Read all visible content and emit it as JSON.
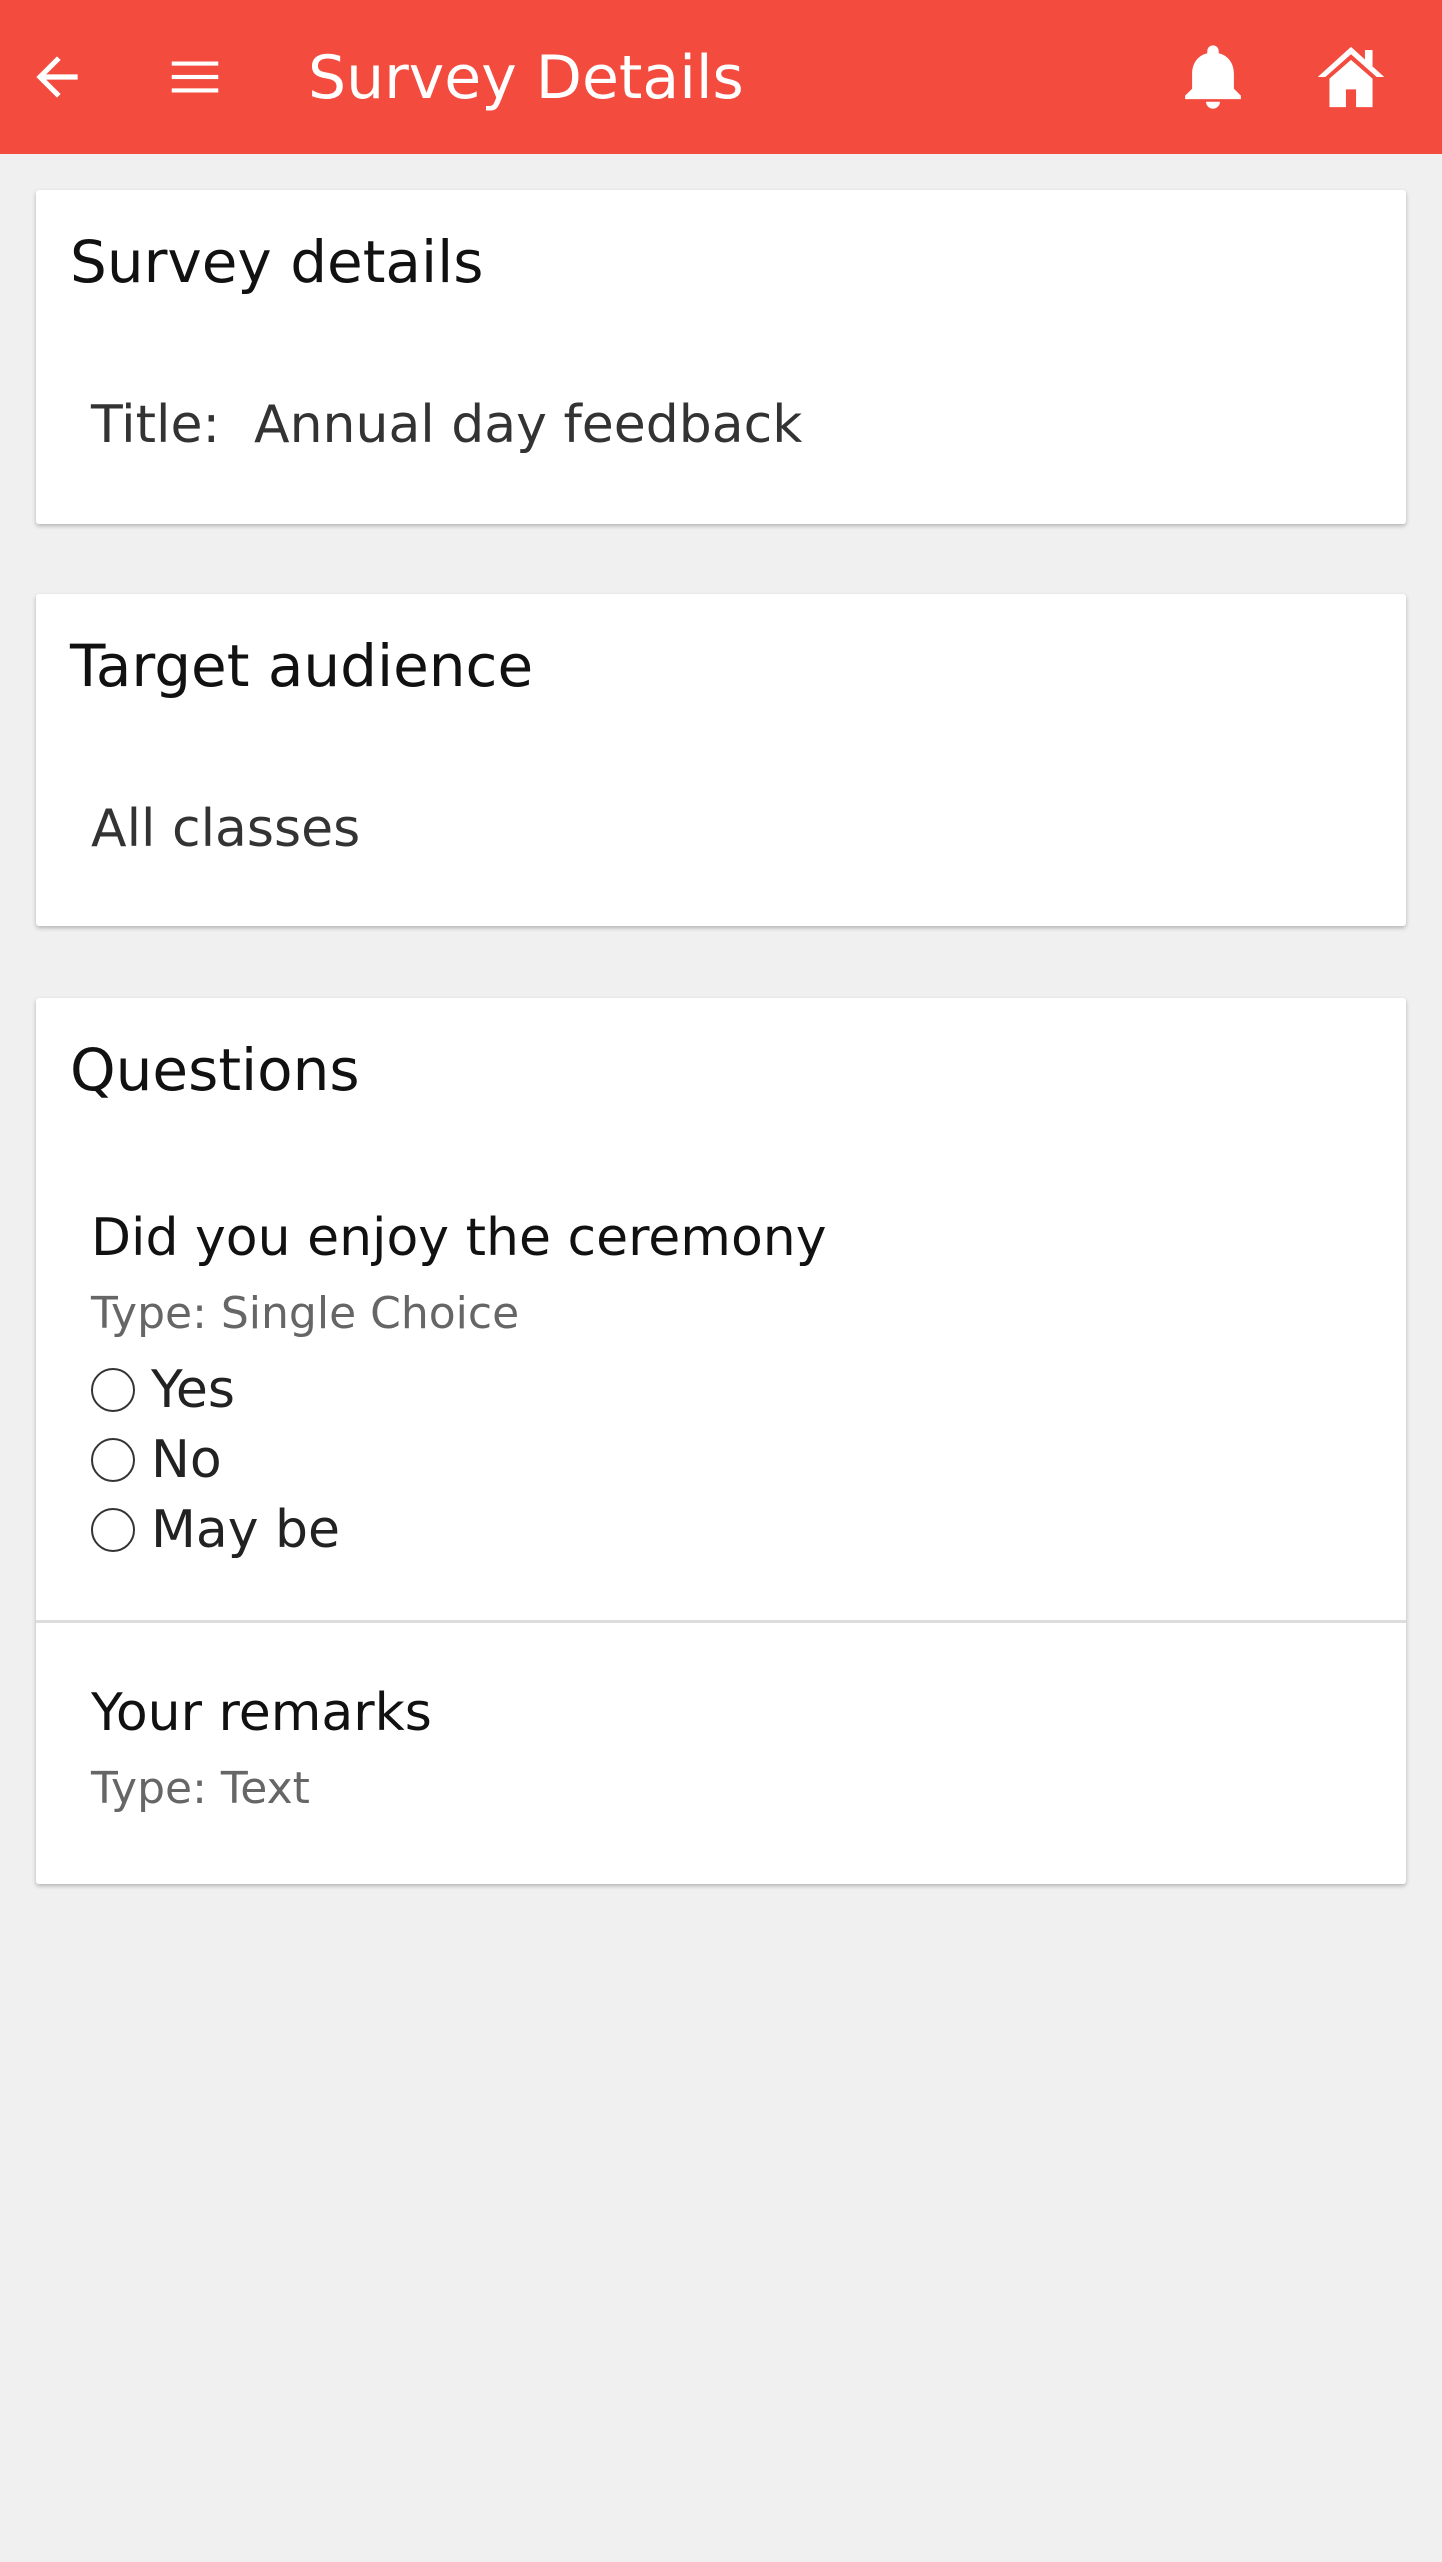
{
  "appbar": {
    "title": "Survey Details",
    "back_icon": "arrow-left-icon",
    "menu_icon": "hamburger-menu-icon",
    "notification_icon": "bell-icon",
    "home_icon": "home-icon",
    "color": "#f44b3f"
  },
  "survey_details": {
    "heading": "Survey details",
    "title_label": "Title:",
    "title_value": "Annual day feedback"
  },
  "target_audience": {
    "heading": "Target audience",
    "value": "All classes"
  },
  "questions": {
    "heading": "Questions",
    "items": [
      {
        "title": "Did you enjoy the ceremony",
        "type": "Type: Single Choice",
        "options": [
          "Yes",
          "No",
          "May be"
        ]
      },
      {
        "title": "Your remarks",
        "type": "Type: Text"
      }
    ]
  }
}
